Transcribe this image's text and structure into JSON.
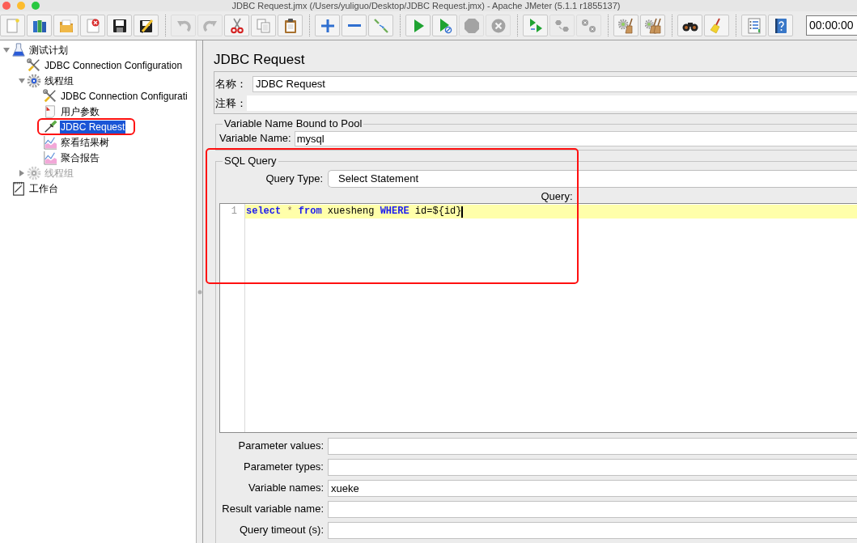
{
  "window": {
    "title": "JDBC Request.jmx (/Users/yuliguo/Desktop/JDBC Request.jmx) - Apache JMeter (5.1.1 r1855137)"
  },
  "toolbar": {
    "groups": [
      {
        "buttons": [
          {
            "kind": "new",
            "disabled": false
          },
          {
            "kind": "templates",
            "disabled": false
          },
          {
            "kind": "open",
            "disabled": false
          },
          {
            "kind": "close",
            "disabled": false
          },
          {
            "kind": "save",
            "disabled": false
          },
          {
            "kind": "save-as",
            "disabled": false
          }
        ]
      },
      {
        "buttons": [
          {
            "kind": "undo",
            "disabled": true
          },
          {
            "kind": "redo",
            "disabled": true
          },
          {
            "kind": "cut",
            "disabled": false
          },
          {
            "kind": "copy",
            "disabled": false
          },
          {
            "kind": "paste",
            "disabled": false
          }
        ]
      },
      {
        "buttons": [
          {
            "kind": "expand",
            "disabled": false
          },
          {
            "kind": "collapse",
            "disabled": false
          },
          {
            "kind": "toggle",
            "disabled": false
          }
        ]
      },
      {
        "buttons": [
          {
            "kind": "start",
            "disabled": false
          },
          {
            "kind": "start-no-pauses",
            "disabled": false
          },
          {
            "kind": "stop",
            "disabled": true
          },
          {
            "kind": "shutdown",
            "disabled": true
          }
        ]
      },
      {
        "buttons": [
          {
            "kind": "remote-start",
            "disabled": false
          },
          {
            "kind": "remote-stop",
            "disabled": true
          },
          {
            "kind": "remote-shutdown",
            "disabled": true
          }
        ]
      },
      {
        "buttons": [
          {
            "kind": "clear",
            "disabled": false
          },
          {
            "kind": "clear-all",
            "disabled": false
          }
        ]
      },
      {
        "buttons": [
          {
            "kind": "search",
            "disabled": false
          },
          {
            "kind": "reset-search",
            "disabled": false
          }
        ]
      },
      {
        "buttons": [
          {
            "kind": "function-helper",
            "disabled": false
          },
          {
            "kind": "help",
            "disabled": false
          }
        ]
      }
    ],
    "timer": "00:00:00"
  },
  "tree": [
    {
      "label": "测试计划",
      "kind": "test-plan",
      "expanded": true,
      "selected": false,
      "disabled": false,
      "framed": false,
      "children": [
        {
          "label": "JDBC Connection Configuration",
          "kind": "config",
          "selected": false,
          "disabled": false,
          "framed": false
        },
        {
          "label": "线程组",
          "kind": "thread-group",
          "expanded": true,
          "selected": false,
          "disabled": false,
          "framed": false,
          "children": [
            {
              "label": "JDBC Connection Configurati",
              "kind": "config",
              "selected": false,
              "disabled": false,
              "framed": false
            },
            {
              "label": "用户参数",
              "kind": "pre-processor",
              "selected": false,
              "disabled": false,
              "framed": false
            },
            {
              "label": "JDBC Request",
              "kind": "sampler",
              "selected": true,
              "disabled": false,
              "framed": true
            },
            {
              "label": "察看结果树",
              "kind": "listener",
              "selected": false,
              "disabled": false,
              "framed": false
            },
            {
              "label": "聚合报告",
              "kind": "listener",
              "selected": false,
              "disabled": false,
              "framed": false
            }
          ]
        },
        {
          "label": "线程组",
          "kind": "thread-group",
          "expanded": false,
          "selected": false,
          "disabled": true,
          "framed": false
        }
      ]
    },
    {
      "label": "工作台",
      "kind": "workbench",
      "selected": false,
      "disabled": false,
      "framed": false
    }
  ],
  "editor": {
    "title": "JDBC Request",
    "name": {
      "label": "名称：",
      "value": "JDBC Request"
    },
    "comment": {
      "label": "注释："
    },
    "pool_group": {
      "title": "Variable Name Bound to Pool",
      "label": "Variable Name:",
      "value": "mysql"
    },
    "sql_group": {
      "title": "SQL Query",
      "framed": true,
      "query_type": {
        "label": "Query Type:",
        "value": "Select Statement"
      },
      "query": {
        "label": "Query:",
        "lines": [
          {
            "number": "1",
            "current": true,
            "tokens": [
              {
                "text": "select",
                "kind": "keyword"
              },
              {
                "text": " * ",
                "kind": "operator"
              },
              {
                "text": "from",
                "kind": "keyword"
              },
              {
                "text": " xuesheng ",
                "kind": "plain"
              },
              {
                "text": "WHERE",
                "kind": "keyword"
              },
              {
                "text": " id=${id}",
                "kind": "plain"
              }
            ]
          }
        ]
      },
      "fields": [
        {
          "label": "Parameter values:"
        },
        {
          "label": "Parameter types:"
        },
        {
          "label": "Variable names:",
          "value": "xueke"
        },
        {
          "label": "Result variable name:"
        },
        {
          "label": "Query timeout (s):"
        }
      ]
    }
  }
}
